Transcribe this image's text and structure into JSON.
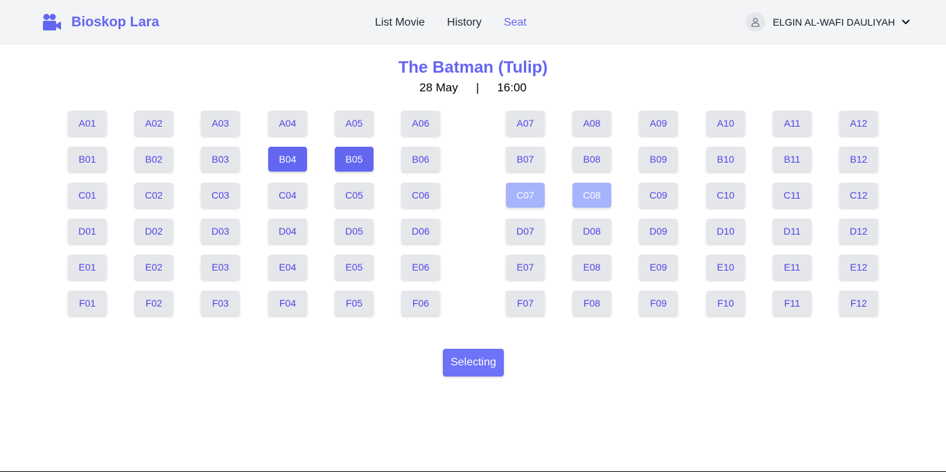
{
  "brand": {
    "name": "Bioskop Lara",
    "icon": "video-camera-icon"
  },
  "nav": {
    "links": [
      "List Movie",
      "History",
      "Seat"
    ],
    "active": "Seat"
  },
  "user": {
    "name": "ELGIN AL-WAFI DAULIYAH",
    "icon": "user-icon",
    "menu_icon": "chevron-down-icon"
  },
  "movie": {
    "title": "The Batman (Tulip)",
    "date": "28 May",
    "separator": "|",
    "time": "16:00"
  },
  "seats": {
    "rows": [
      [
        "A01",
        "A02",
        "A03",
        "A04",
        "A05",
        "A06",
        "A07",
        "A08",
        "A09",
        "A10",
        "A11",
        "A12"
      ],
      [
        "B01",
        "B02",
        "B03",
        "B04",
        "B05",
        "B06",
        "B07",
        "B08",
        "B09",
        "B10",
        "B11",
        "B12"
      ],
      [
        "C01",
        "C02",
        "C03",
        "C04",
        "C05",
        "C06",
        "C07",
        "C08",
        "C09",
        "C10",
        "C11",
        "C12"
      ],
      [
        "D01",
        "D02",
        "D03",
        "D04",
        "D05",
        "D06",
        "D07",
        "D08",
        "D09",
        "D10",
        "D11",
        "D12"
      ],
      [
        "E01",
        "E02",
        "E03",
        "E04",
        "E05",
        "E06",
        "E07",
        "E08",
        "E09",
        "E10",
        "E11",
        "E12"
      ],
      [
        "F01",
        "F02",
        "F03",
        "F04",
        "F05",
        "F06",
        "F07",
        "F08",
        "F09",
        "F10",
        "F11",
        "F12"
      ]
    ],
    "selected": [
      "B04",
      "B05"
    ],
    "booked": [
      "C07",
      "C08"
    ]
  },
  "action_button": {
    "label": "Selecting"
  },
  "colors": {
    "accent": "#6366f1",
    "seat_default": "#e5e7eb",
    "seat_selected": "#6366f1",
    "seat_booked": "#a5b4fc",
    "navbar_bg": "#f3f4f6"
  }
}
